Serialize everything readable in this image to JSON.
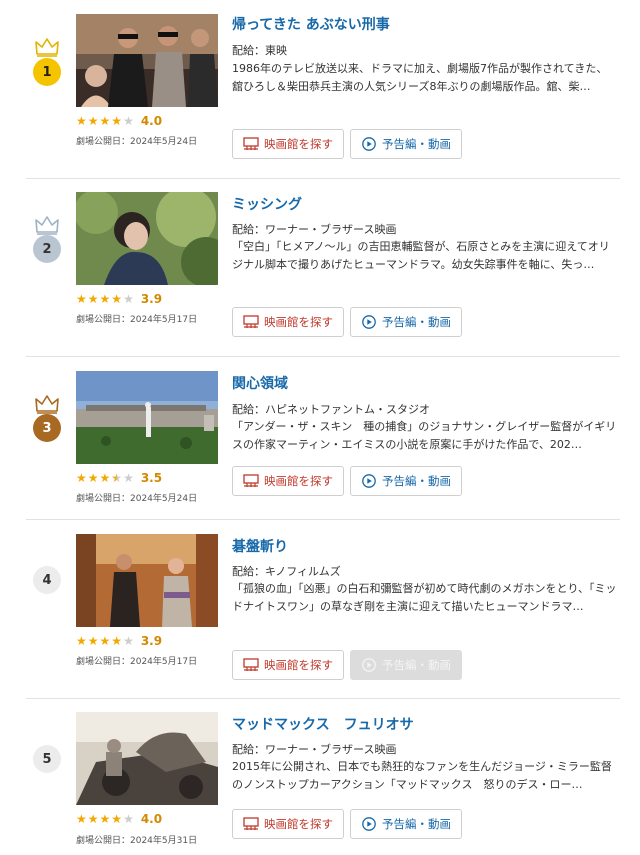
{
  "movies": [
    {
      "rank": "1",
      "title": "帰ってきた あぶない刑事",
      "distributor": "配給：東映",
      "description": "1986年のテレビ放送以来、ドラマに加え、劇場版7作品が製作されてきた、舘ひろし＆柴田恭兵主演の人気シリーズ8年ぶりの劇場版作品。舘、柴…",
      "rating": "4.0",
      "rating_value": 4.0,
      "release": "劇場公開日：2024年5月24日",
      "theater_button": "映画館を探す",
      "trailer_button": "予告編・動画",
      "trailer_available": true
    },
    {
      "rank": "2",
      "title": "ミッシング",
      "distributor": "配給：ワーナー・ブラザース映画",
      "description": "「空白」「ヒメアノ～ル」の吉田恵輔監督が、石原さとみを主演に迎えてオリジナル脚本で撮りあげたヒューマンドラマ。幼女失踪事件を軸に、失っ…",
      "rating": "3.9",
      "rating_value": 3.9,
      "release": "劇場公開日：2024年5月17日",
      "theater_button": "映画館を探す",
      "trailer_button": "予告編・動画",
      "trailer_available": true
    },
    {
      "rank": "3",
      "title": "関心領域",
      "distributor": "配給：ハピネットファントム・スタジオ",
      "description": "「アンダー・ザ・スキン　種の捕食」のジョナサン・グレイザー監督がイギリスの作家マーティン・エイミスの小説を原案に手がけた作品で、202…",
      "rating": "3.5",
      "rating_value": 3.5,
      "release": "劇場公開日：2024年5月24日",
      "theater_button": "映画館を探す",
      "trailer_button": "予告編・動画",
      "trailer_available": true
    },
    {
      "rank": "4",
      "title": "碁盤斬り",
      "distributor": "配給：キノフィルムズ",
      "description": "「孤狼の血」「凶悪」の白石和彌監督が初めて時代劇のメガホンをとり、「ミッドナイトスワン」の草なぎ剛を主演に迎えて描いたヒューマンドラマ…",
      "rating": "3.9",
      "rating_value": 3.9,
      "release": "劇場公開日：2024年5月17日",
      "theater_button": "映画館を探す",
      "trailer_button": "予告編・動画",
      "trailer_available": false
    },
    {
      "rank": "5",
      "title": "マッドマックス　フュリオサ",
      "distributor": "配給：ワーナー・ブラザース映画",
      "description": "2015年に公開され、日本でも熱狂的なファンを生んだジョージ・ミラー監督のノンストップカーアクション「マッドマックス　怒りのデス・ロー…",
      "rating": "4.0",
      "rating_value": 4.0,
      "release": "劇場公開日：2024年5月31日",
      "theater_button": "映画館を探す",
      "trailer_button": "予告編・動画",
      "trailer_available": true
    }
  ],
  "colors": {
    "title": "#1769aa",
    "gold": "#f5c400",
    "silver": "#b9c6d2",
    "bronze": "#a86a22",
    "star": "#f2a800",
    "theater_button": "#c0392b"
  },
  "icons": [
    "crown-icon",
    "star-icon",
    "theater-icon",
    "play-icon"
  ]
}
